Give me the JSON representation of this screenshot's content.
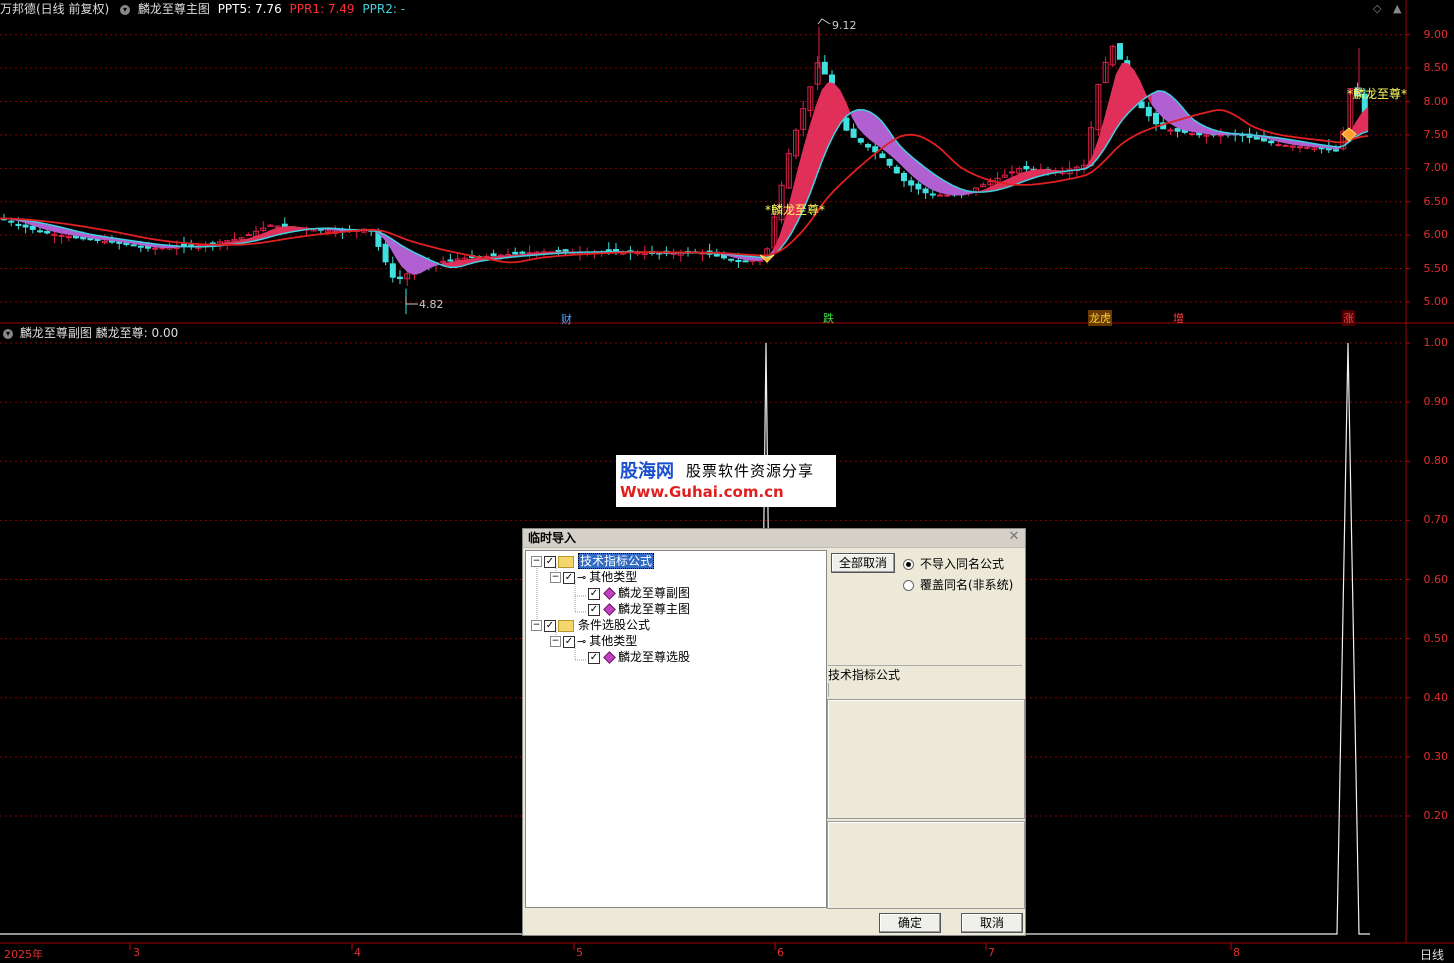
{
  "main_header": {
    "stock": "万邦德(日线 前复权)",
    "indicator": "麟龙至尊主图",
    "ppt5": "PPT5: 7.76",
    "ppr1": "PPR1: 7.49",
    "ppr2": "PPR2: -"
  },
  "sub_header": {
    "indicator": "麟龙至尊副图",
    "value": "麟龙至尊: 0.00"
  },
  "price_axis": [
    "9.00",
    "8.50",
    "8.00",
    "7.50",
    "7.00",
    "6.50",
    "6.00",
    "5.50",
    "5.00"
  ],
  "sub_axis": [
    "1.00",
    "0.90",
    "0.80",
    "0.70",
    "0.60",
    "0.50",
    "0.40",
    "0.30",
    "0.20"
  ],
  "annotations": {
    "high": "9.12",
    "low": "4.82",
    "signal1": "*麟龙至尊*",
    "signal2": "*麟龙至尊*"
  },
  "events": [
    {
      "label": "财",
      "color": "#4da6ff"
    },
    {
      "label": "跌",
      "color": "#40e040"
    },
    {
      "label": "龙虎",
      "color": "#ffcc33"
    },
    {
      "label": "增",
      "color": "#ff4040"
    },
    {
      "label": "涨",
      "color": "#ff4040"
    }
  ],
  "dates": [
    "2025年",
    "3",
    "4",
    "5",
    "6",
    "7",
    "8"
  ],
  "period_label": "日线",
  "watermark": {
    "brand": "股海网",
    "tagline": "股票软件资源分享",
    "url": "Www.Guhai.com.cn"
  },
  "dialog": {
    "title": "临时导入",
    "tree": [
      {
        "label": "技术指标公式",
        "level": 0,
        "type": "folder",
        "selected": true
      },
      {
        "label": "其他类型",
        "level": 1,
        "type": "key"
      },
      {
        "label": "麟龙至尊副图",
        "level": 2,
        "type": "item"
      },
      {
        "label": "麟龙至尊主图",
        "level": 2,
        "type": "item"
      },
      {
        "label": "条件选股公式",
        "level": 0,
        "type": "folder"
      },
      {
        "label": "其他类型",
        "level": 1,
        "type": "key"
      },
      {
        "label": "麟龙至尊选股",
        "level": 2,
        "type": "item"
      }
    ],
    "deselect_all": "全部取消",
    "radio_no_import": "不导入同名公式",
    "radio_overwrite": "覆盖同名(非系统)",
    "detail_title": "技术指标公式",
    "ok": "确定",
    "cancel": "取消"
  },
  "colors": {
    "up": "#e0204a",
    "down": "#40e0e0",
    "ma_red": "#e02020",
    "ma_cyan": "#40d0e0",
    "band_pink": "#e0305a",
    "band_purple": "#b060d0",
    "grid": "#8b0000"
  },
  "chart_data": {
    "type": "candlestick",
    "price_range": [
      4.7,
      9.25
    ],
    "signal_range": [
      0,
      1.0
    ],
    "signal_peaks": [
      1.0,
      1.0
    ]
  }
}
